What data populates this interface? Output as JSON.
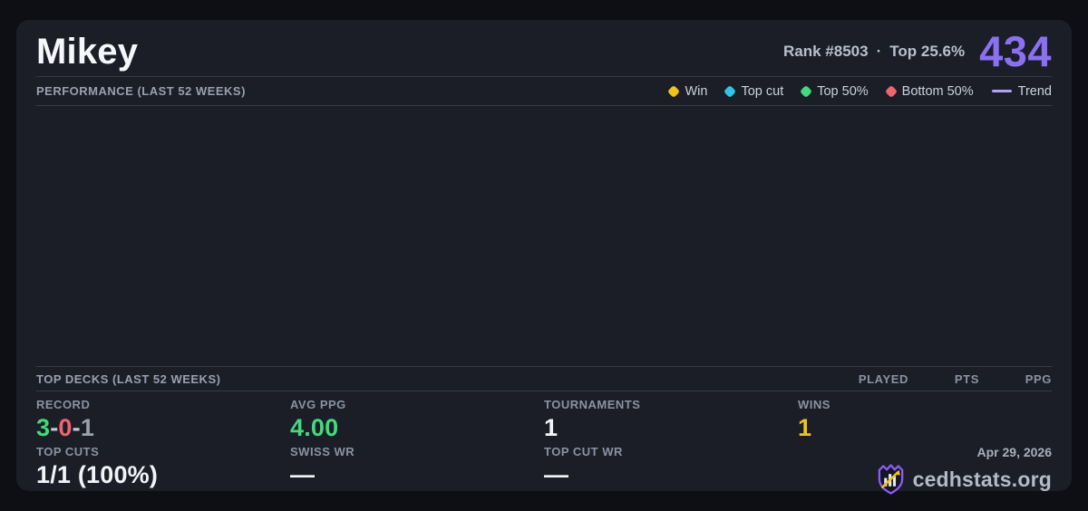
{
  "page": {
    "background": "#0e0f14",
    "card_background": "#1b1e27"
  },
  "header": {
    "player_name": "Mikey",
    "rank": "Rank #8503",
    "separator": "·",
    "top_percent": "Top 25.6%",
    "score": "434",
    "score_color": "#8b70f2"
  },
  "performance": {
    "title": "PERFORMANCE (LAST 52 WEEKS)",
    "chart_empty": true,
    "legend": [
      {
        "label": "Win",
        "color": "#efc319",
        "marker": "diamond"
      },
      {
        "label": "Top cut",
        "color": "#2ec5ea",
        "marker": "diamond"
      },
      {
        "label": "Top 50%",
        "color": "#43d97d",
        "marker": "diamond"
      },
      {
        "label": "Bottom 50%",
        "color": "#f0646e",
        "marker": "diamond"
      },
      {
        "label": "Trend",
        "color": "#b2a2f7",
        "marker": "line"
      }
    ]
  },
  "top_decks": {
    "title": "TOP DECKS (LAST 52 WEEKS)",
    "columns": [
      "PLAYED",
      "PTS",
      "PPG"
    ],
    "rows": []
  },
  "stats": {
    "record": {
      "label": "RECORD",
      "wins": "3",
      "losses": "0",
      "draws": "1",
      "separator": "-",
      "wins_color": "#43d97d",
      "losses_color": "#f0646e",
      "draws_color": "#99a1ad",
      "separator_color": "#c3c8d2"
    },
    "avg_ppg": {
      "label": "AVG PPG",
      "value": "4.00",
      "color": "#43d97d"
    },
    "tournaments": {
      "label": "TOURNAMENTS",
      "value": "1"
    },
    "wins": {
      "label": "WINS",
      "value": "1",
      "color": "#efc319"
    },
    "top_cuts": {
      "label": "TOP CUTS",
      "value": "1/1 (100%)"
    },
    "swiss_wr": {
      "label": "SWISS WR",
      "value": "—"
    },
    "top_cut_wr": {
      "label": "TOP CUT WR",
      "value": "—"
    }
  },
  "footer": {
    "date": "Apr 29, 2026",
    "brand": "cedhstats.org"
  }
}
